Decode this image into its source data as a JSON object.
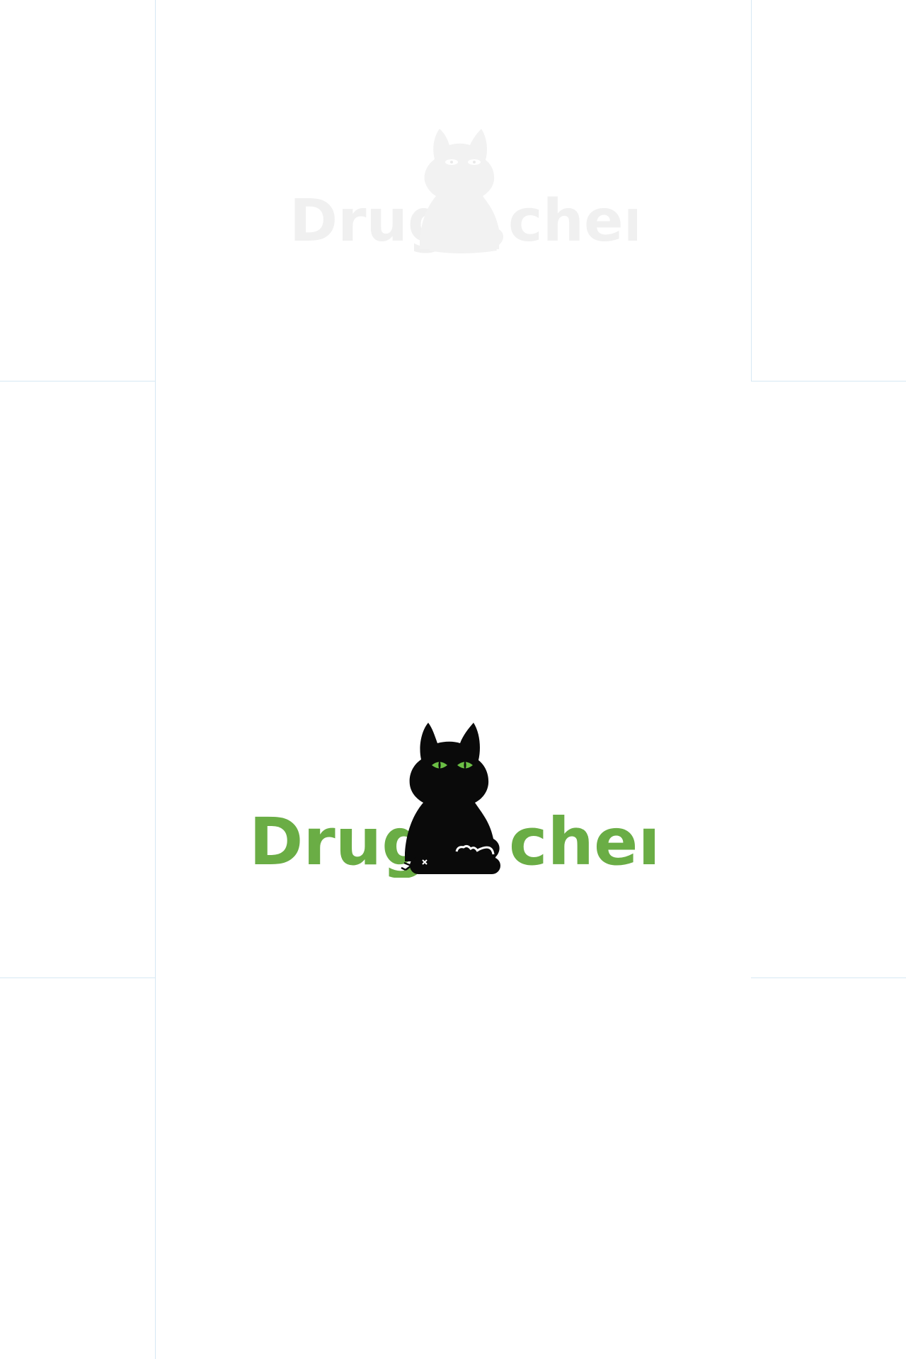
{
  "logo_faint": {
    "left_text": "Drug",
    "right_text": "cher",
    "text_color": "#f0f0f0",
    "cat_color": "#f2f2f2",
    "eye_color": "#ffffff"
  },
  "logo_main": {
    "left_text": "Drug",
    "right_text": "cher",
    "text_color": "#6aad45",
    "cat_color": "#0a0a0a",
    "eye_color": "#6bbf45",
    "mark_color": "#ffffff"
  },
  "guides": {
    "color": "#d6e8f4"
  }
}
